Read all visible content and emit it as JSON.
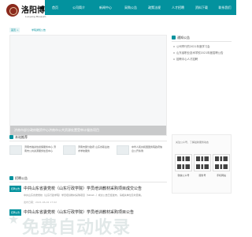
{
  "header": {
    "logo_title": "洛阳博物",
    "logo_sub": "Luoyang Museum",
    "nav": [
      {
        "label": "首页"
      },
      {
        "label": "公司简介"
      },
      {
        "label": "新闻中心"
      },
      {
        "label": "采购公告"
      },
      {
        "label": "政策法规"
      },
      {
        "label": "人才招聘"
      },
      {
        "label": "资料下载"
      },
      {
        "label": "联系我们"
      }
    ]
  },
  "breadcrumb": {
    "home": "首页 >",
    "sep": "",
    "current": "学院通知公告"
  },
  "hero": {
    "caption": "济南市部分政府融资中心济南市公共资源处置受审计服务项目"
  },
  "notice": {
    "title": "通知公告",
    "items": [
      "公司举行的2021年度学习会",
      "山东省职业技术学校2021年度招聘公告",
      "招聘中心人才招聘"
    ]
  },
  "recommend": {
    "title": "本站推荐",
    "cards": [
      {
        "text": "济南市融资性担保服务中心 济南市公共资源服务处置中心"
      },
      {
        "text": "济南市部分政府 山东省职业技术学校服务"
      },
      {
        "text": "中华人民共和国国务院政府信息公开条例"
      }
    ]
  },
  "follow": {
    "text": "关注公众号，了解最新服务动态",
    "qrs": [
      {
        "label": "微信公众号"
      },
      {
        "label": "服务号"
      },
      {
        "label": "手机网站"
      }
    ]
  },
  "listing": {
    "title": "招聘公告",
    "items": [
      {
        "tag": "招聘公告",
        "title": "中共山东省委党校（山东行政学院）学员培训教材采购项目成交公告",
        "desc": "中共山东省委党校（山东行政学院）学员培训教材采购项目（SDGP...）成交公告已经发布，请相关单位及时查看。",
        "date": "发布日期：2021-06-02 17:02"
      },
      {
        "tag": "招聘公告",
        "title": "中共山东省委党校（山东行政学院）学员培训教材采购项目公告",
        "desc": "",
        "date": ""
      }
    ]
  },
  "watermark": {
    "text": "免费自动收录",
    "star": "★"
  },
  "colors": {
    "accent": "#03929e",
    "logo": "#8b2a1d"
  }
}
